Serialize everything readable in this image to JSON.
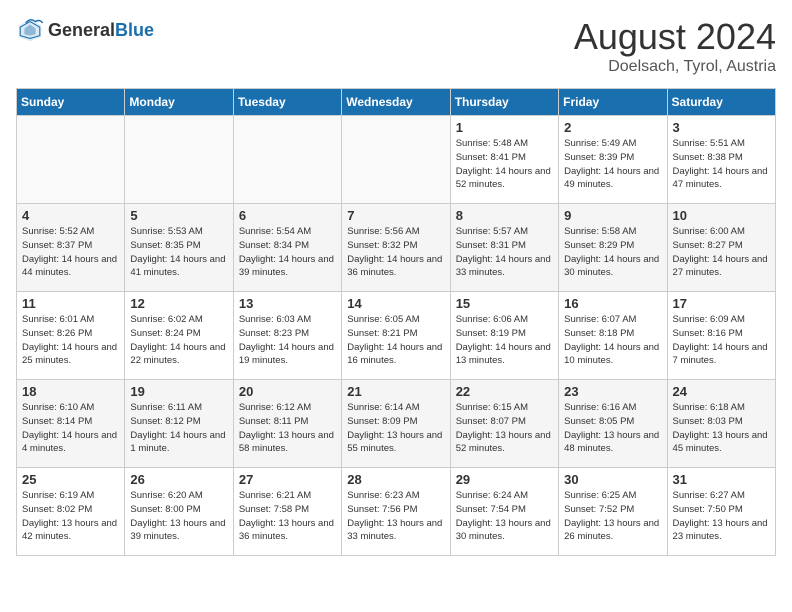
{
  "header": {
    "logo_general": "General",
    "logo_blue": "Blue",
    "title": "August 2024",
    "subtitle": "Doelsach, Tyrol, Austria"
  },
  "weekdays": [
    "Sunday",
    "Monday",
    "Tuesday",
    "Wednesday",
    "Thursday",
    "Friday",
    "Saturday"
  ],
  "weeks": [
    [
      {
        "day": "",
        "detail": ""
      },
      {
        "day": "",
        "detail": ""
      },
      {
        "day": "",
        "detail": ""
      },
      {
        "day": "",
        "detail": ""
      },
      {
        "day": "1",
        "detail": "Sunrise: 5:48 AM\nSunset: 8:41 PM\nDaylight: 14 hours\nand 52 minutes."
      },
      {
        "day": "2",
        "detail": "Sunrise: 5:49 AM\nSunset: 8:39 PM\nDaylight: 14 hours\nand 49 minutes."
      },
      {
        "day": "3",
        "detail": "Sunrise: 5:51 AM\nSunset: 8:38 PM\nDaylight: 14 hours\nand 47 minutes."
      }
    ],
    [
      {
        "day": "4",
        "detail": "Sunrise: 5:52 AM\nSunset: 8:37 PM\nDaylight: 14 hours\nand 44 minutes."
      },
      {
        "day": "5",
        "detail": "Sunrise: 5:53 AM\nSunset: 8:35 PM\nDaylight: 14 hours\nand 41 minutes."
      },
      {
        "day": "6",
        "detail": "Sunrise: 5:54 AM\nSunset: 8:34 PM\nDaylight: 14 hours\nand 39 minutes."
      },
      {
        "day": "7",
        "detail": "Sunrise: 5:56 AM\nSunset: 8:32 PM\nDaylight: 14 hours\nand 36 minutes."
      },
      {
        "day": "8",
        "detail": "Sunrise: 5:57 AM\nSunset: 8:31 PM\nDaylight: 14 hours\nand 33 minutes."
      },
      {
        "day": "9",
        "detail": "Sunrise: 5:58 AM\nSunset: 8:29 PM\nDaylight: 14 hours\nand 30 minutes."
      },
      {
        "day": "10",
        "detail": "Sunrise: 6:00 AM\nSunset: 8:27 PM\nDaylight: 14 hours\nand 27 minutes."
      }
    ],
    [
      {
        "day": "11",
        "detail": "Sunrise: 6:01 AM\nSunset: 8:26 PM\nDaylight: 14 hours\nand 25 minutes."
      },
      {
        "day": "12",
        "detail": "Sunrise: 6:02 AM\nSunset: 8:24 PM\nDaylight: 14 hours\nand 22 minutes."
      },
      {
        "day": "13",
        "detail": "Sunrise: 6:03 AM\nSunset: 8:23 PM\nDaylight: 14 hours\nand 19 minutes."
      },
      {
        "day": "14",
        "detail": "Sunrise: 6:05 AM\nSunset: 8:21 PM\nDaylight: 14 hours\nand 16 minutes."
      },
      {
        "day": "15",
        "detail": "Sunrise: 6:06 AM\nSunset: 8:19 PM\nDaylight: 14 hours\nand 13 minutes."
      },
      {
        "day": "16",
        "detail": "Sunrise: 6:07 AM\nSunset: 8:18 PM\nDaylight: 14 hours\nand 10 minutes."
      },
      {
        "day": "17",
        "detail": "Sunrise: 6:09 AM\nSunset: 8:16 PM\nDaylight: 14 hours\nand 7 minutes."
      }
    ],
    [
      {
        "day": "18",
        "detail": "Sunrise: 6:10 AM\nSunset: 8:14 PM\nDaylight: 14 hours\nand 4 minutes."
      },
      {
        "day": "19",
        "detail": "Sunrise: 6:11 AM\nSunset: 8:12 PM\nDaylight: 14 hours\nand 1 minute."
      },
      {
        "day": "20",
        "detail": "Sunrise: 6:12 AM\nSunset: 8:11 PM\nDaylight: 13 hours\nand 58 minutes."
      },
      {
        "day": "21",
        "detail": "Sunrise: 6:14 AM\nSunset: 8:09 PM\nDaylight: 13 hours\nand 55 minutes."
      },
      {
        "day": "22",
        "detail": "Sunrise: 6:15 AM\nSunset: 8:07 PM\nDaylight: 13 hours\nand 52 minutes."
      },
      {
        "day": "23",
        "detail": "Sunrise: 6:16 AM\nSunset: 8:05 PM\nDaylight: 13 hours\nand 48 minutes."
      },
      {
        "day": "24",
        "detail": "Sunrise: 6:18 AM\nSunset: 8:03 PM\nDaylight: 13 hours\nand 45 minutes."
      }
    ],
    [
      {
        "day": "25",
        "detail": "Sunrise: 6:19 AM\nSunset: 8:02 PM\nDaylight: 13 hours\nand 42 minutes."
      },
      {
        "day": "26",
        "detail": "Sunrise: 6:20 AM\nSunset: 8:00 PM\nDaylight: 13 hours\nand 39 minutes."
      },
      {
        "day": "27",
        "detail": "Sunrise: 6:21 AM\nSunset: 7:58 PM\nDaylight: 13 hours\nand 36 minutes."
      },
      {
        "day": "28",
        "detail": "Sunrise: 6:23 AM\nSunset: 7:56 PM\nDaylight: 13 hours\nand 33 minutes."
      },
      {
        "day": "29",
        "detail": "Sunrise: 6:24 AM\nSunset: 7:54 PM\nDaylight: 13 hours\nand 30 minutes."
      },
      {
        "day": "30",
        "detail": "Sunrise: 6:25 AM\nSunset: 7:52 PM\nDaylight: 13 hours\nand 26 minutes."
      },
      {
        "day": "31",
        "detail": "Sunrise: 6:27 AM\nSunset: 7:50 PM\nDaylight: 13 hours\nand 23 minutes."
      }
    ]
  ]
}
